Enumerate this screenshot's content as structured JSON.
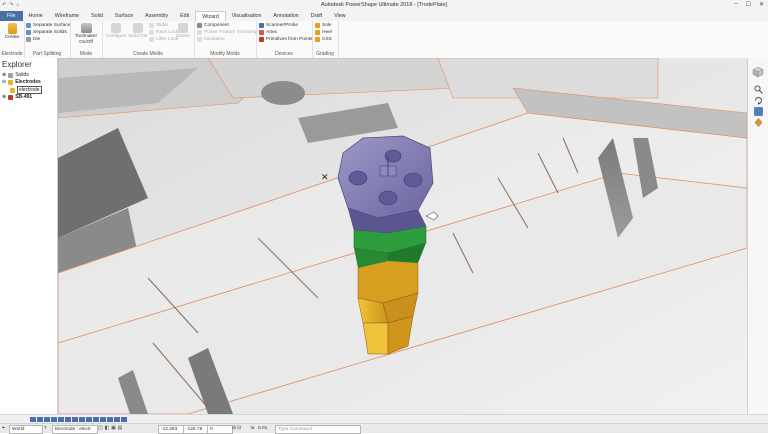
{
  "window": {
    "title": "Autodesk PowerShape Ultimate 2018 - [TrodePlate]",
    "quick_access": [
      "↶",
      "↷",
      "⌂"
    ],
    "controls": {
      "minimize": "–",
      "maximize": "☐",
      "close": "✕"
    }
  },
  "tabs": [
    {
      "label": "File"
    },
    {
      "label": "Home"
    },
    {
      "label": "Wireframe"
    },
    {
      "label": "Solid"
    },
    {
      "label": "Surface"
    },
    {
      "label": "Assembly"
    },
    {
      "label": "Edit"
    },
    {
      "label": "Wizard"
    },
    {
      "label": "Visualisation"
    },
    {
      "label": "Annotation"
    },
    {
      "label": "Draft"
    },
    {
      "label": "View"
    }
  ],
  "active_tab": "Wizard",
  "ribbon": {
    "groups": {
      "electrode": {
        "label": "Electrode",
        "create": "Create"
      },
      "part_splitting": {
        "label": "Part Splitting",
        "items": [
          "Separate Surface",
          "Separate Solids",
          "Die"
        ]
      },
      "mode": {
        "label": "Mode",
        "toolmaker": "Toolmaker On/Off"
      },
      "create_molds": {
        "label": "Create Molds",
        "items": [
          "Configure",
          "Mold Die",
          "Slider",
          "Rack Lock",
          "Lifter Lock",
          "Slider",
          "Dowel"
        ]
      },
      "modify_molds": {
        "label": "Modify Molds",
        "items": [
          "Component",
          "Power Feature Trimming",
          "Insulation"
        ]
      },
      "devices": {
        "label": "Devices",
        "items": [
          "Scanner/Probe",
          "Artec",
          "Primitives from Points"
        ]
      },
      "grading": {
        "label": "Grading",
        "items": [
          "Sole",
          "Heel",
          "CSS"
        ]
      }
    }
  },
  "explorer": {
    "title": "Explorer",
    "tree": [
      {
        "label": "Solids"
      },
      {
        "label": "Electrodes"
      },
      {
        "label": "electrode"
      },
      {
        "label": "SB-491"
      }
    ]
  },
  "status": {
    "colors": [
      "#4a6fa5",
      "#4a6fa5",
      "#4a6fa5",
      "#4a6fa5",
      "#4a6fa5",
      "#4a6fa5",
      "#4a6fa5",
      "#4a6fa5",
      "#4a6fa5",
      "#4a6fa5",
      "#4a6fa5",
      "#4a6fa5",
      "#4a6fa5",
      "#4a6fa5"
    ],
    "workplane": "World",
    "level": "7",
    "electrode_field": "Electrode : electr",
    "x": "-12.283",
    "y": "-126.78",
    "z": "0",
    "tolerance": "0.01",
    "command_placeholder": "Type Command"
  },
  "theme": {
    "accent": "#4a6fa5",
    "electrode_head": "#8580b8",
    "band": "#2e9e3c",
    "stem": "#e5b424",
    "edge": "#e8895a"
  }
}
